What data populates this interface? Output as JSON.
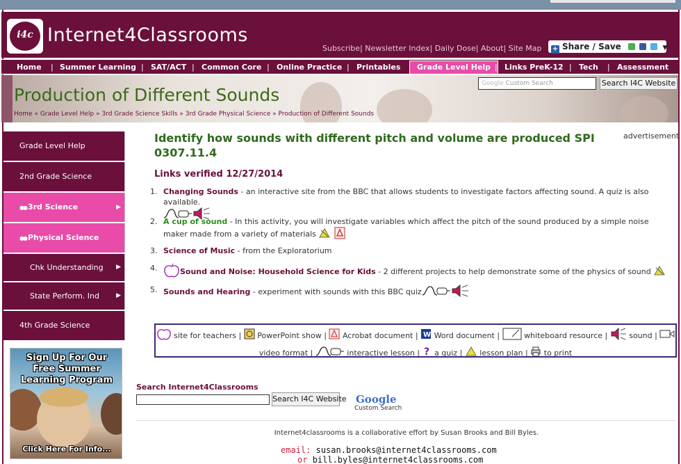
{
  "header": {
    "logo_text": "i4c",
    "site_title": "Internet4Classrooms",
    "top_links": [
      "Subscribe",
      "Newsletter Index",
      "Daily Dose",
      "About",
      "Site Map"
    ],
    "share_label": "Share / Save"
  },
  "nav": {
    "items": [
      "Home",
      "Summer Learning",
      "SAT/ACT",
      "Common Core",
      "Online Practice",
      "Printables",
      "Grade Level Help",
      "Links PreK-12",
      "Tech",
      "Assessment"
    ],
    "active": "Grade Level Help"
  },
  "banner": {
    "title": "Production of Different Sounds",
    "breadcrumb": [
      "Home",
      "Grade Level Help",
      "3rd Grade Science Skills",
      "3rd Grade Physical Science",
      "Production of Different Sounds"
    ],
    "search_placeholder": "Custom Search",
    "search_button": "Search I4C Website"
  },
  "sidebar": {
    "items": [
      {
        "label": "Grade Level Help"
      },
      {
        "label": "2nd Grade Science"
      },
      {
        "label": "3rd Science"
      },
      {
        "label": "Physical Science"
      },
      {
        "label": "Chk Understanding"
      },
      {
        "label": "State Perform. Ind"
      },
      {
        "label": "4th Grade Science"
      }
    ],
    "promo": {
      "lines": [
        "Sign Up For Our",
        "Free Summer",
        "Learning Program"
      ],
      "cta": "Click Here For Info..."
    }
  },
  "main": {
    "heading": "Identify how sounds with different pitch and volume are produced SPI 0307.11.4",
    "advertisement": "advertisement",
    "verified": "Links verified 12/27/2014",
    "links": [
      {
        "num": "1.",
        "title": "Changing Sounds",
        "desc": " - an interactive site from the BBC that allows students to investigate factors affecting sound. A quiz is also available."
      },
      {
        "num": "2.",
        "title": "A cup of sound",
        "desc": " - In this activity, you will investigate variables which affect the pitch of the sound produced by a simple noise maker made from a variety of materials"
      },
      {
        "num": "3.",
        "title": "Science of Music",
        "desc": " - from the Exploratorium"
      },
      {
        "num": "4.",
        "title": "Sound and Noise: Household Science for Kids",
        "desc": " - 2 different projects to help demonstrate some of the physics of sound"
      },
      {
        "num": "5.",
        "title": "Sounds and Hearing",
        "desc": " - experiment with sounds with this BBC quiz"
      }
    ]
  },
  "legend": {
    "items": [
      "site for teachers",
      "PowerPoint show",
      "Acrobat document",
      "Word document",
      "whiteboard resource",
      "sound",
      "video format",
      "interactive lesson",
      "a quiz",
      "lesson plan",
      "to print"
    ]
  },
  "bottom_search": {
    "label": "Search Internet4Classrooms",
    "button": "Search I4C Website",
    "google": "Google",
    "google_sub": "Custom Search"
  },
  "footer": {
    "text": "Internet4classrooms is a collaborative effort by Susan Brooks and Bill Byles.",
    "email_label": "email:",
    "email1": "susan.brooks@internet4classrooms.com",
    "or_label": "or",
    "email2": "bill.byles@internet4classrooms.com"
  },
  "colors": {
    "brand": "#6b0f3b",
    "accent_pink": "#e94ba8",
    "heading_green": "#2f6a1c"
  }
}
